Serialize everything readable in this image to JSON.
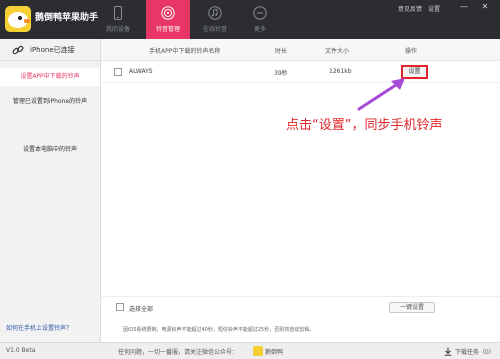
{
  "app": {
    "name": "鹅倒鸭苹果助手",
    "top_links": [
      "意见反馈",
      "设置"
    ],
    "window_buttons": [
      "—",
      "✕"
    ]
  },
  "nav": {
    "tabs": [
      {
        "label": "我的设备",
        "icon": "phone-icon",
        "active": false
      },
      {
        "label": "铃音管理",
        "icon": "ringtone-icon",
        "active": true
      },
      {
        "label": "在线铃音",
        "icon": "online-ringtone-icon",
        "active": false
      },
      {
        "label": "更多",
        "icon": "more-icon",
        "active": false
      }
    ]
  },
  "sidebar": {
    "connection": "iPhone已连接",
    "items": [
      {
        "label": "设置APP中下载的铃声",
        "active": true
      },
      {
        "label": "管理已设置到iPhone的铃声",
        "active": false
      },
      {
        "label": "设置本电脑中的铃声",
        "active": false
      }
    ],
    "help_link": "如何在手机上设置铃声？"
  },
  "table": {
    "headers": [
      "手机APP中下载的铃声名称",
      "时长",
      "文件大小",
      "操作"
    ],
    "rows": [
      {
        "name": "ALWAYS",
        "duration": "39秒",
        "size": "1261kb",
        "action": "设置"
      }
    ]
  },
  "annotation": "点击“设置”，同步手机铃声",
  "footer": {
    "select_all": "选择全部",
    "bulk_button": "一键设置",
    "note": "因iOS系统限制，电源铃声不能超过40秒，短信铃声不能超过25秒，否则将自动剪辑。"
  },
  "statusbar": {
    "version": "V1.0 Beta",
    "contact": "任何问题，一切一番服，请关注微信公众号：",
    "wechat": "鹅倒鸭",
    "download_task": "下载任务（0）"
  },
  "colors": {
    "titlebar": "#2b2d31",
    "accent": "#e83766",
    "annotation": "#e0262b",
    "sidebar": "#f2f2f2"
  }
}
